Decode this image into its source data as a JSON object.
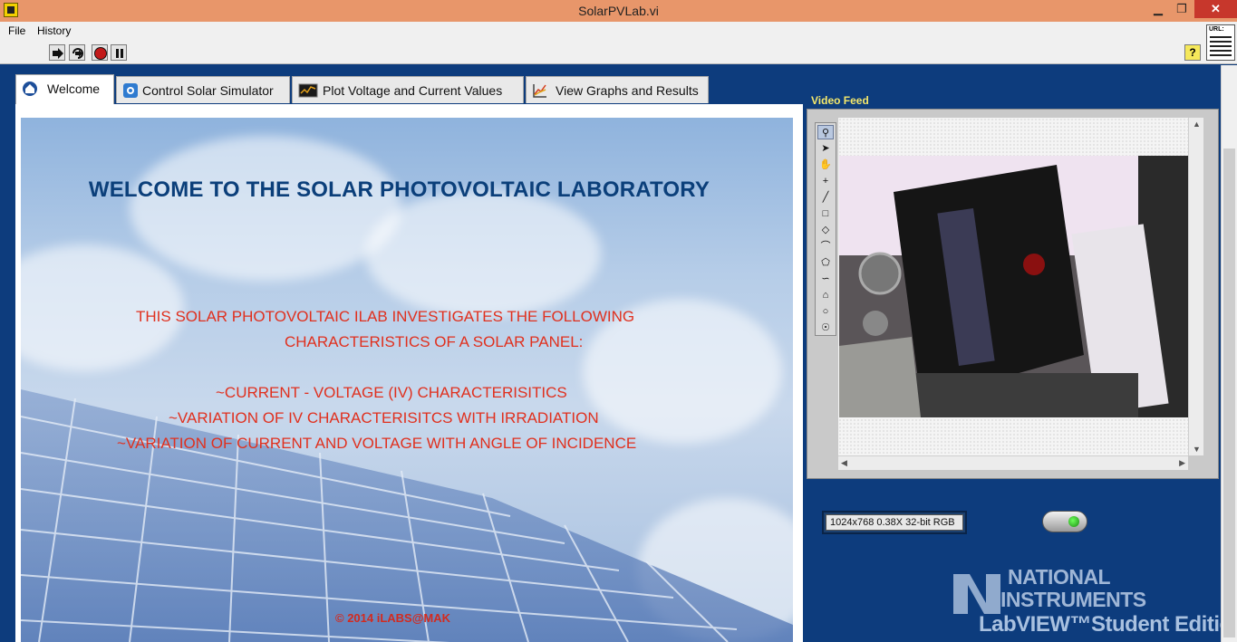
{
  "window": {
    "title": "SolarPVLab.vi",
    "buttons": {
      "minimize": "▁",
      "maximize": "❐",
      "close": "✕"
    }
  },
  "menu": {
    "file": "File",
    "history": "History"
  },
  "toolbar": {
    "icons": [
      "run-arrow-icon",
      "run-continuously-icon",
      "abort-icon",
      "pause-icon"
    ],
    "help": "?",
    "url_icon_label": "URL:"
  },
  "tabs": [
    {
      "label": "Welcome",
      "icon": "home-icon",
      "active": true
    },
    {
      "label": "Control Solar Simulator",
      "icon": "simulator-icon",
      "active": false
    },
    {
      "label": "Plot Voltage and Current Values",
      "icon": "oscilloscope-icon",
      "active": false
    },
    {
      "label": "View Graphs and Results",
      "icon": "graph-icon",
      "active": false
    }
  ],
  "welcome": {
    "heading": "WELCOME TO THE SOLAR PHOTOVOLTAIC LABORATORY",
    "intro_line1": "THIS SOLAR PHOTOVOLTAIC ILAB INVESTIGATES THE FOLLOWING",
    "intro_line2": "CHARACTERISTICS OF A SOLAR PANEL:",
    "item1": "~CURRENT - VOLTAGE (IV) CHARACTERISITICS",
    "item2": "~VARIATION OF IV CHARACTERISITCS WITH IRRADIATION",
    "item3": "~VARIATION OF CURRENT AND VOLTAGE WITH ANGLE OF INCIDENCE",
    "copyright": "© 2014 iLABS@MAK"
  },
  "video": {
    "label": "Video Feed",
    "readout": "1024x768 0.38X 32-bit RGB",
    "tools": [
      "zoom-icon",
      "pointer-icon",
      "pan-hand-icon",
      "point-icon",
      "line-icon",
      "rectangle-icon",
      "rotated-rect-icon",
      "annulus-icon",
      "polygon-icon",
      "freehand-icon",
      "broken-line-icon",
      "oval-icon",
      "freehand-region-icon"
    ]
  },
  "branding": {
    "line1": "NATIONAL",
    "line2": "INSTRUMENTS",
    "line3": "LabVIEW™Student Edition"
  },
  "colors": {
    "background": "#0d3c7d",
    "titlebar": "#e8966a",
    "heading": "#0b3f7a",
    "intro_text": "#e0301e",
    "video_label": "#f5e86a"
  }
}
